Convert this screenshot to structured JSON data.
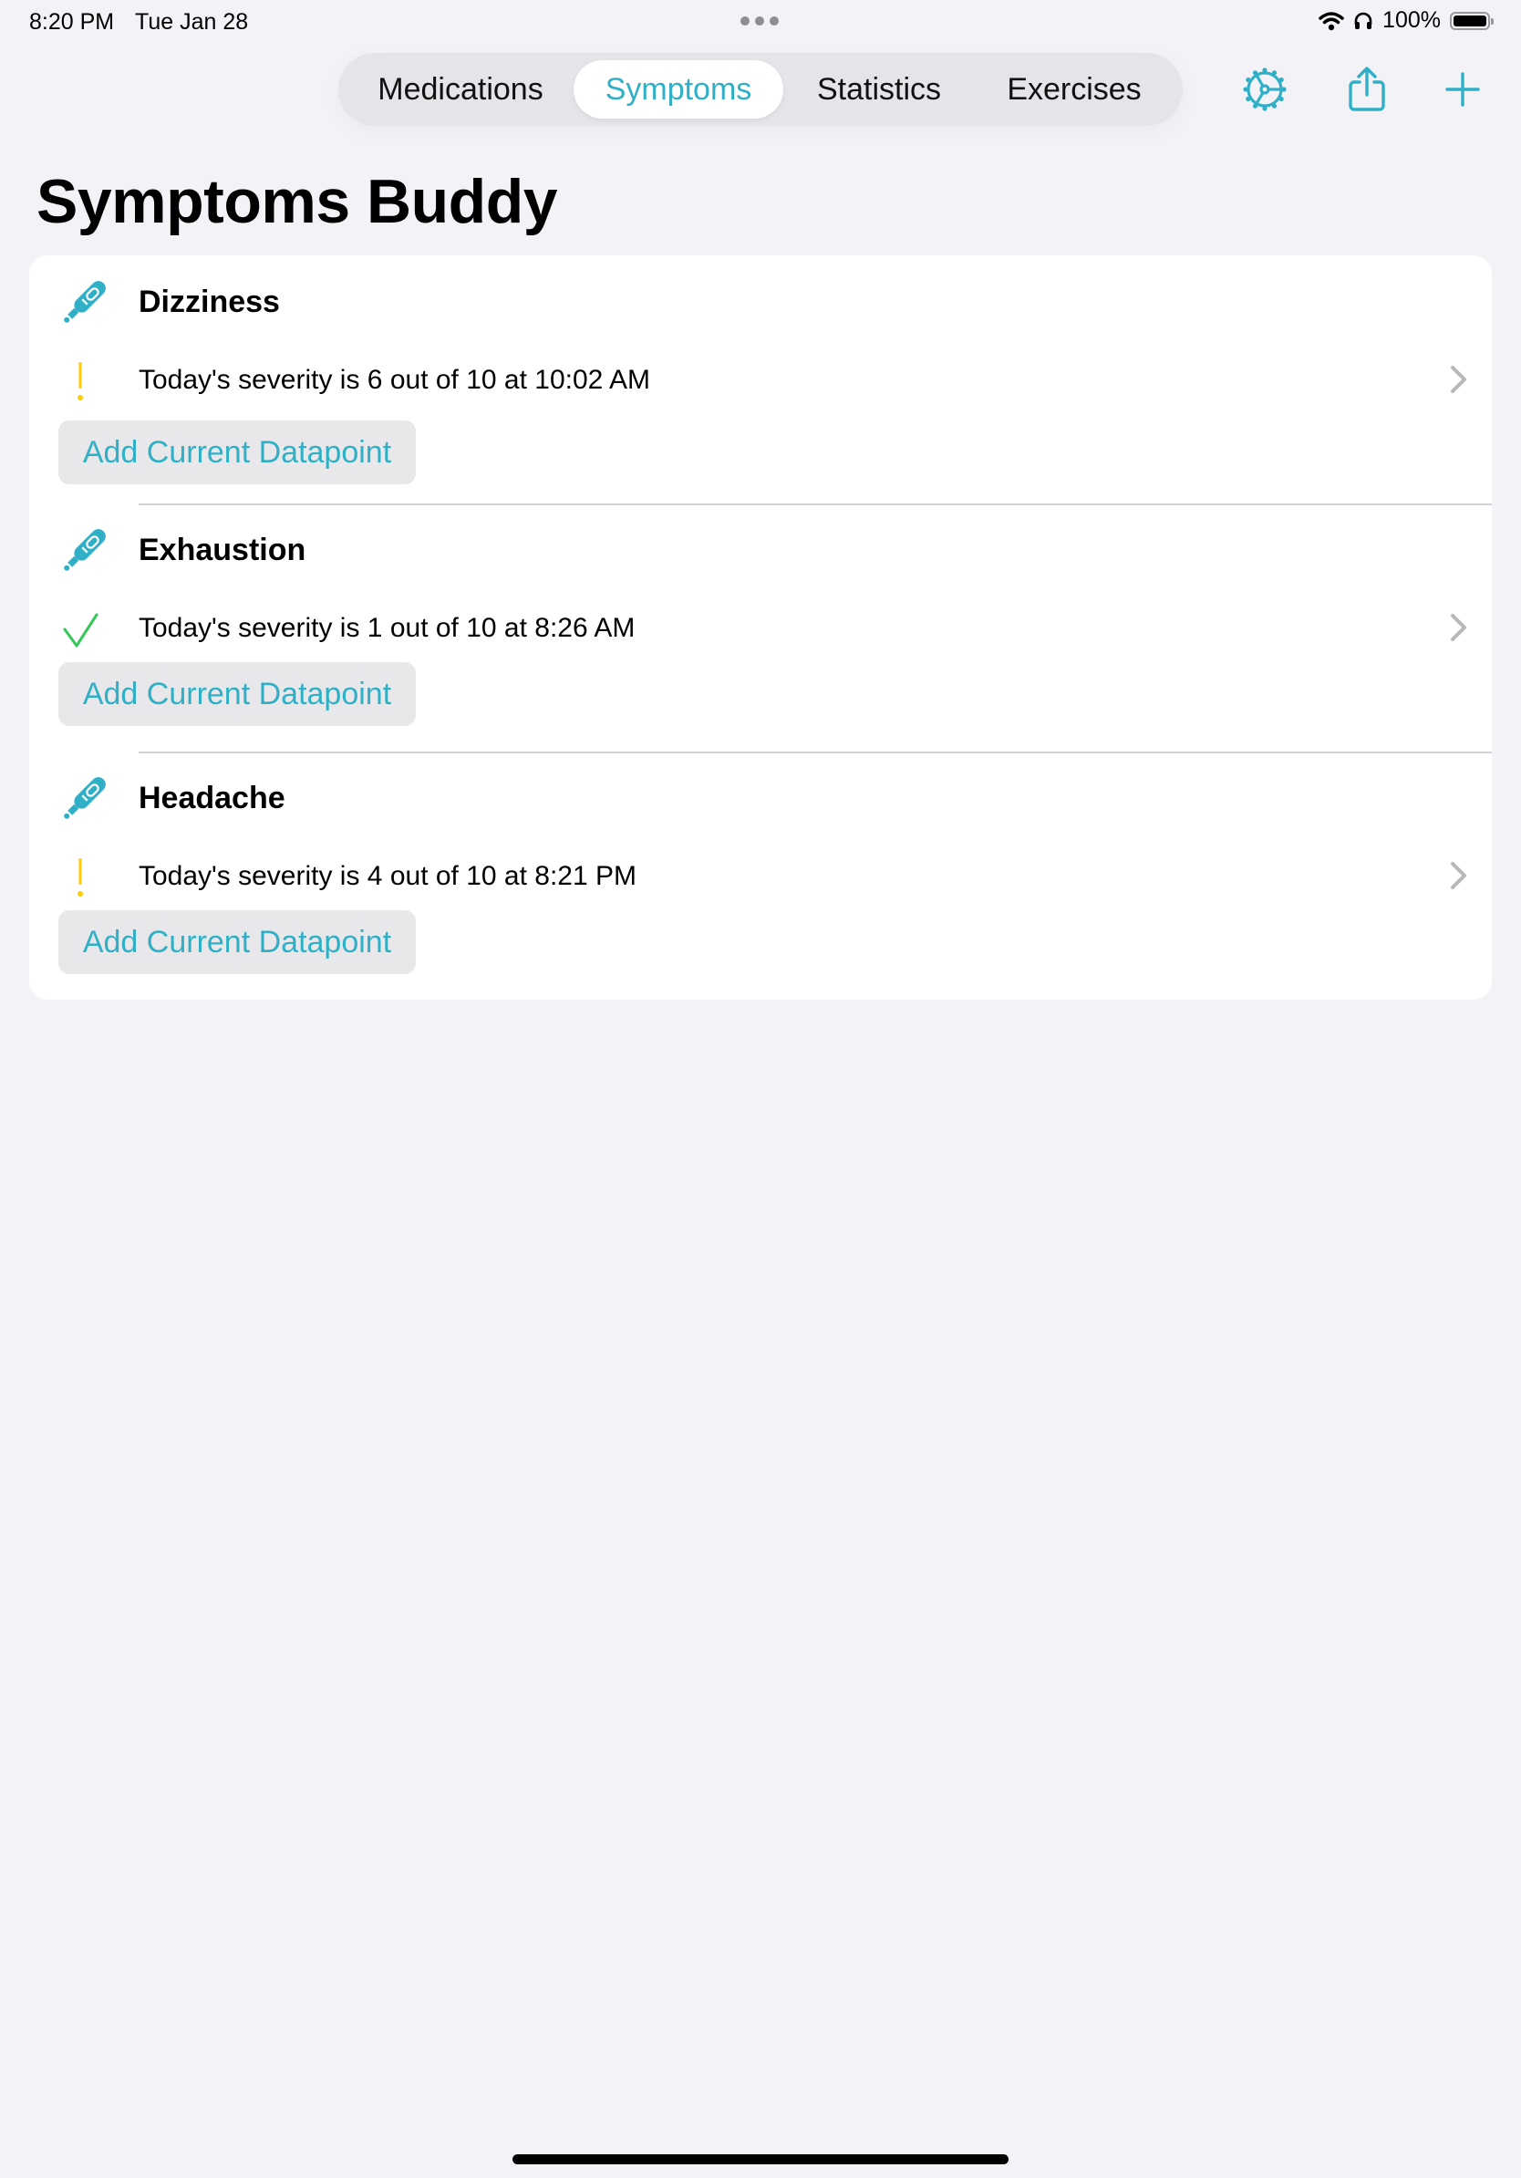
{
  "status_bar": {
    "time": "8:20 PM",
    "date": "Tue Jan 28",
    "battery": "100%",
    "icons": [
      "wifi-icon",
      "headphones-icon",
      "battery-icon"
    ]
  },
  "tabs": [
    {
      "label": "Medications",
      "selected": false
    },
    {
      "label": "Symptoms",
      "selected": true
    },
    {
      "label": "Statistics",
      "selected": false
    },
    {
      "label": "Exercises",
      "selected": false
    }
  ],
  "toolbar": {
    "icons": [
      "settings-gear-icon",
      "share-icon",
      "add-icon"
    ]
  },
  "page_title": "Symptoms Buddy",
  "colors": {
    "accent": "#30b0c7",
    "warning": "#ffcc00",
    "ok": "#34c759",
    "background": "#f2f2f7"
  },
  "symptoms": [
    {
      "name": "Dizziness",
      "status": "warning",
      "status_icon": "exclamation-icon",
      "summary": "Today's severity is 6 out of 10 at 10:02 AM",
      "severity": 6,
      "max": 10,
      "time": "10:02 AM",
      "button_label": "Add Current Datapoint"
    },
    {
      "name": "Exhaustion",
      "status": "ok",
      "status_icon": "checkmark-icon",
      "summary": "Today's severity is 1 out of 10 at 8:26 AM",
      "severity": 1,
      "max": 10,
      "time": "8:26 AM",
      "button_label": "Add Current Datapoint"
    },
    {
      "name": "Headache",
      "status": "warning",
      "status_icon": "exclamation-icon",
      "summary": "Today's severity is 4 out of 10 at 8:21 PM",
      "severity": 4,
      "max": 10,
      "time": "8:21 PM",
      "button_label": "Add Current Datapoint"
    }
  ]
}
